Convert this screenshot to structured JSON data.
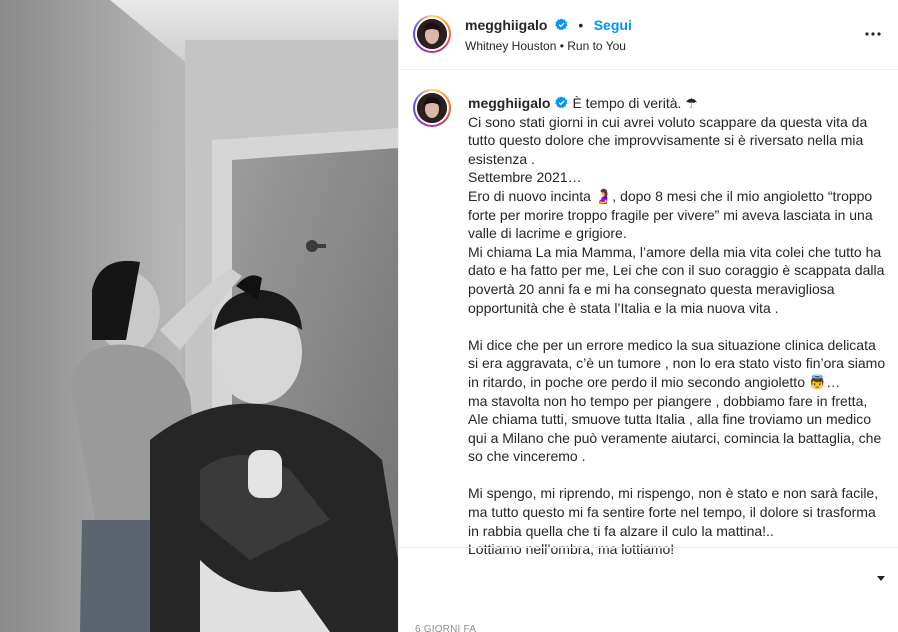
{
  "post": {
    "media_alt": "",
    "author": {
      "username": "megghiigalo",
      "verified": true
    },
    "header": {
      "separator": "•",
      "follow_label": "Segui",
      "audio": "Whitney Houston • Run to You"
    },
    "caption": {
      "lines": [
        "È tempo di verità. ☂",
        "Ci sono stati giorni in cui avrei voluto scappare da questa vita da tutto questo dolore che improvvisamente si è riversato nella mia esistenza .",
        "Settembre 2021…",
        "Ero di nuovo incinta 🤰, dopo 8 mesi che il mio angioletto “troppo forte per morire troppo fragile per vivere” mi aveva lasciata in una valle di lacrime e grigiore.",
        "Mi chiama La mia Mamma, l’amore della mia vita colei che tutto ha dato e ha fatto per me, Lei che con il suo coraggio è scappata dalla povertà 20 anni fa e mi ha consegnato questa meravigliosa opportunità che è stata l’Italia e la mia nuova vita .",
        "",
        "Mi dice che per un errore medico la sua situazione clinica delicata si era aggravata, c’è un tumore , non lo era stato visto fin’ora siamo in ritardo, in poche ore perdo il mio secondo angioletto 👼…",
        "ma stavolta non ho tempo per piangere , dobbiamo fare in fretta, Ale chiama tutti, smuove tutta Italia , alla fine troviamo un medico qui a Milano che può veramente aiutarci, comincia la battaglia, che so che vinceremo .",
        "",
        "Mi spengo, mi riprendo, mi rispengo, non è stato e non sarà facile, ma tutto questo mi fa sentire forte nel tempo, il dolore si trasforma in rabbia quella che ti fa alzare il culo la mattina!..",
        "Lottiamo nell’ombra, ma lottiamo!"
      ]
    },
    "timestamp": "6 GIORNI FA"
  },
  "icons": {
    "more": "more-horizontal-icon",
    "verified": "verified-badge-icon",
    "scroll": "chevron-down-icon"
  },
  "colors": {
    "accent": "#0095f6",
    "text": "#262626",
    "muted": "#8e8e8e",
    "divider": "#efefef"
  }
}
